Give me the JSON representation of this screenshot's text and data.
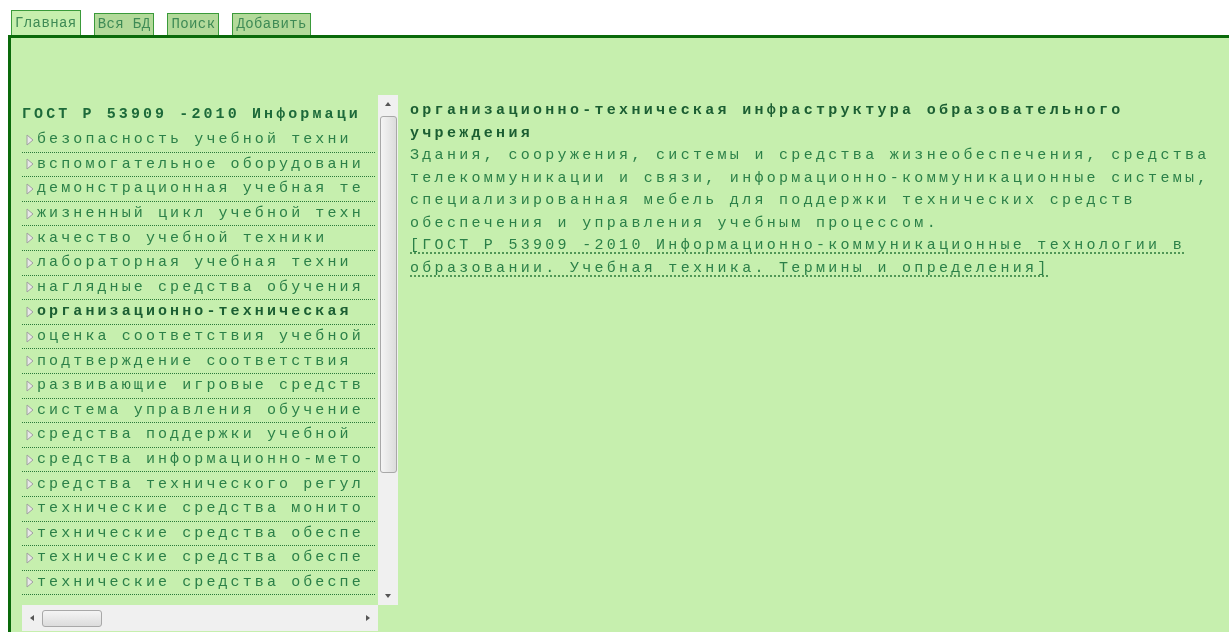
{
  "tabs": [
    {
      "label": "Главная",
      "selected": true
    },
    {
      "label": "Вся БД",
      "selected": false
    },
    {
      "label": "Поиск",
      "selected": false
    },
    {
      "label": "Добавить",
      "selected": false
    }
  ],
  "term_list": {
    "heading": "ГОСТ Р 53909 -2010 Информаци",
    "items": [
      {
        "label": "безопасность учебной техни",
        "selected": false
      },
      {
        "label": "вспомогательное оборудовани",
        "selected": false
      },
      {
        "label": "демонстрационная учебная те",
        "selected": false
      },
      {
        "label": "жизненный цикл учебной техн",
        "selected": false
      },
      {
        "label": "качество учебной техники",
        "selected": false
      },
      {
        "label": "лабораторная учебная техни",
        "selected": false
      },
      {
        "label": "наглядные средства обучения",
        "selected": false
      },
      {
        "label": "организационно-техническая",
        "selected": true
      },
      {
        "label": "оценка соответствия учебной",
        "selected": false
      },
      {
        "label": "подтверждение соответствия",
        "selected": false
      },
      {
        "label": "развивающие игровые средств",
        "selected": false
      },
      {
        "label": "система управления обучение",
        "selected": false
      },
      {
        "label": "средства поддержки учебной",
        "selected": false
      },
      {
        "label": "средства информационно-мето",
        "selected": false
      },
      {
        "label": "средства технического регул",
        "selected": false
      },
      {
        "label": "технические средства монито",
        "selected": false
      },
      {
        "label": "технические средства обеспе",
        "selected": false
      },
      {
        "label": "технические средства обеспе",
        "selected": false
      },
      {
        "label": "технические средства обеспе",
        "selected": false
      }
    ]
  },
  "definition": {
    "term": "организационно-техническая инфраструктура образовательного учреждения",
    "text": "Здания, сооружения, системы и средства жизнеобеспечения, средства телекоммуникации и связи, информационно-коммуникационные системы, специализированная мебель для поддержки технических средств обеспечения и управления учебным процессом.",
    "source": "[ГОСТ Р 53909 -2010 Информационно-коммуникационные технологии в образовании. Учебная техника. Термины и определения]"
  }
}
